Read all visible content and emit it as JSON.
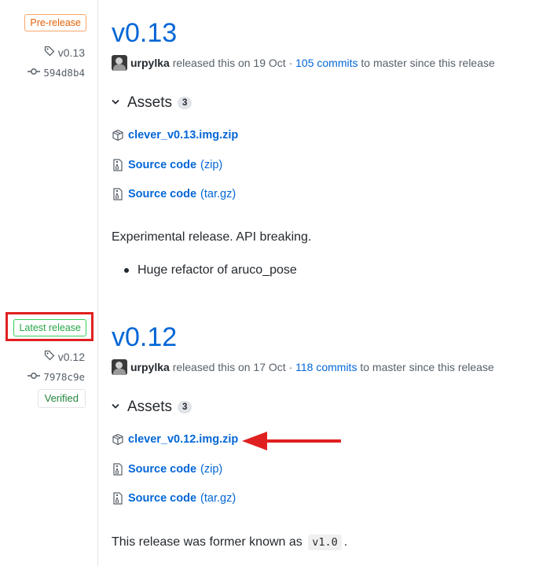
{
  "releases": [
    {
      "badge": "Pre-release",
      "tag": "v0.13",
      "commit": "594d8b4",
      "version": "v0.13",
      "author": "urpylka",
      "released_text": "released this on 19 Oct ·",
      "commits_link": "105 commits",
      "commits_suffix": "to master since this release",
      "assets_label": "Assets",
      "assets_count": "3",
      "assets": [
        {
          "name": "clever_v0.13.img.zip",
          "ext": "",
          "icon": "package-icon"
        },
        {
          "name": "Source code",
          "ext": "(zip)",
          "icon": "file-zip-icon"
        },
        {
          "name": "Source code",
          "ext": "(tar.gz)",
          "icon": "file-zip-icon"
        }
      ],
      "description": "Experimental release. API breaking.",
      "bullets": [
        "Huge refactor of aruco_pose"
      ]
    },
    {
      "badge": "Latest release",
      "tag": "v0.12",
      "commit": "7978c9e",
      "verified": "Verified",
      "version": "v0.12",
      "author": "urpylka",
      "released_text": "released this on 17 Oct ·",
      "commits_link": "118 commits",
      "commits_suffix": "to master since this release",
      "assets_label": "Assets",
      "assets_count": "3",
      "assets": [
        {
          "name": "clever_v0.12.img.zip",
          "ext": "",
          "icon": "package-icon"
        },
        {
          "name": "Source code",
          "ext": "(zip)",
          "icon": "file-zip-icon"
        },
        {
          "name": "Source code",
          "ext": "(tar.gz)",
          "icon": "file-zip-icon"
        }
      ],
      "description_prefix": "This release was former known as",
      "description_code": "v1.0",
      "description_suffix": "."
    }
  ],
  "colors": {
    "link": "#0366d6",
    "pre_release": "#e36209",
    "latest_release": "#28a745",
    "annotation_red": "#e02020"
  }
}
